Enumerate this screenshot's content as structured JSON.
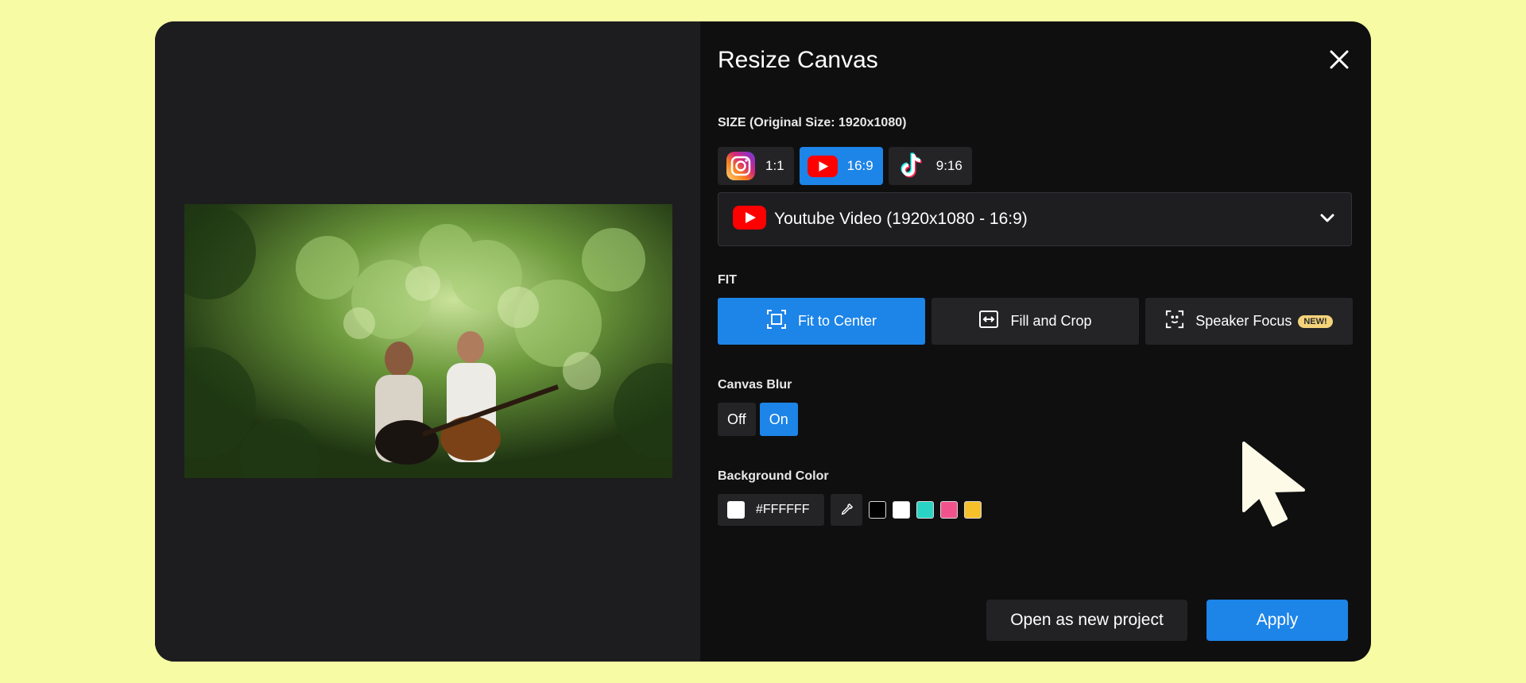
{
  "dialog": {
    "title": "Resize Canvas",
    "close_icon": "close-icon"
  },
  "size": {
    "label": "SIZE (Original Size: 1920x1080)",
    "ratios": [
      {
        "icon": "instagram-icon",
        "label": "1:1",
        "active": false
      },
      {
        "icon": "youtube-icon",
        "label": "16:9",
        "active": true
      },
      {
        "icon": "tiktok-icon",
        "label": "9:16",
        "active": false
      }
    ],
    "preset_icon": "youtube-icon",
    "preset": "Youtube Video (1920x1080 - 16:9)",
    "dropdown_icon": "chevron-down-icon"
  },
  "fit": {
    "label": "FIT",
    "options": [
      {
        "icon": "fit-center-icon",
        "label": "Fit to Center",
        "active": true
      },
      {
        "icon": "fill-crop-icon",
        "label": "Fill and Crop",
        "active": false
      },
      {
        "icon": "speaker-focus-icon",
        "label": "Speaker Focus",
        "badge": "NEW!",
        "active": false
      }
    ]
  },
  "blur": {
    "label": "Canvas Blur",
    "off": "Off",
    "on": "On",
    "selected": "On"
  },
  "background": {
    "label": "Background Color",
    "hex": "#FFFFFF",
    "picker_icon": "eyedropper-icon",
    "swatches": [
      "#000000",
      "#ffffff",
      "#2ad4c4",
      "#f0538c",
      "#f5c02a"
    ]
  },
  "actions": {
    "open_new": "Open as new project",
    "apply": "Apply"
  },
  "colors": {
    "page_bg": "#f7fca4",
    "modal_bg": "#0f0f10",
    "accent": "#1d84e8"
  }
}
